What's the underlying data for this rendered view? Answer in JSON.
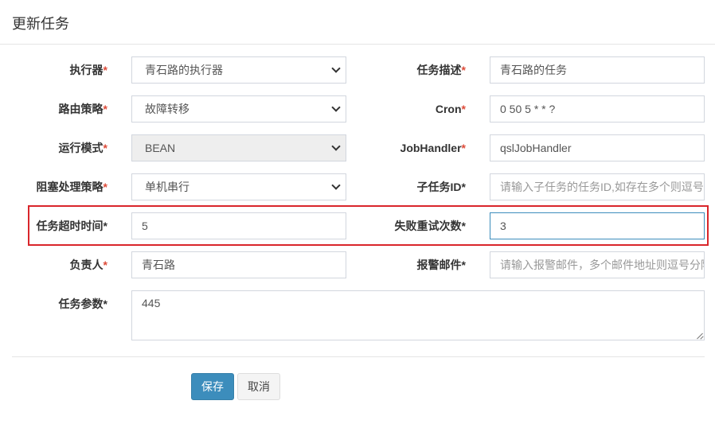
{
  "dialog": {
    "title": "更新任务"
  },
  "form": {
    "executor": {
      "label": "执行器",
      "required_mark": "*",
      "value": "青石路的执行器"
    },
    "task_desc": {
      "label": "任务描述",
      "required_mark": "*",
      "value": "青石路的任务"
    },
    "route_strategy": {
      "label": "路由策略",
      "required_mark": "*",
      "value": "故障转移"
    },
    "cron": {
      "label": "Cron",
      "required_mark": "*",
      "value": "0 50 5 * * ?"
    },
    "run_mode": {
      "label": "运行模式",
      "required_mark": "*",
      "value": "BEAN"
    },
    "job_handler": {
      "label": "JobHandler",
      "required_mark": "*",
      "value": "qslJobHandler"
    },
    "block_strategy": {
      "label": "阻塞处理策略",
      "required_mark": "*",
      "value": "单机串行"
    },
    "child_job_id": {
      "label": "子任务ID*",
      "placeholder": "请输入子任务的任务ID,如存在多个则逗号分隔"
    },
    "timeout": {
      "label": "任务超时时间*",
      "value": "5"
    },
    "retry_count": {
      "label": "失败重试次数*",
      "value": "3"
    },
    "owner": {
      "label": "负责人",
      "required_mark": "*",
      "value": "青石路"
    },
    "alarm_email": {
      "label": "报警邮件*",
      "placeholder": "请输入报警邮件，多个邮件地址则逗号分隔"
    },
    "params": {
      "label": "任务参数*",
      "value": "445"
    }
  },
  "footer": {
    "save_label": "保存",
    "cancel_label": "取消"
  },
  "colors": {
    "primary": "#3c8dbc",
    "required": "#dd4b39",
    "highlight": "#d9262b"
  }
}
